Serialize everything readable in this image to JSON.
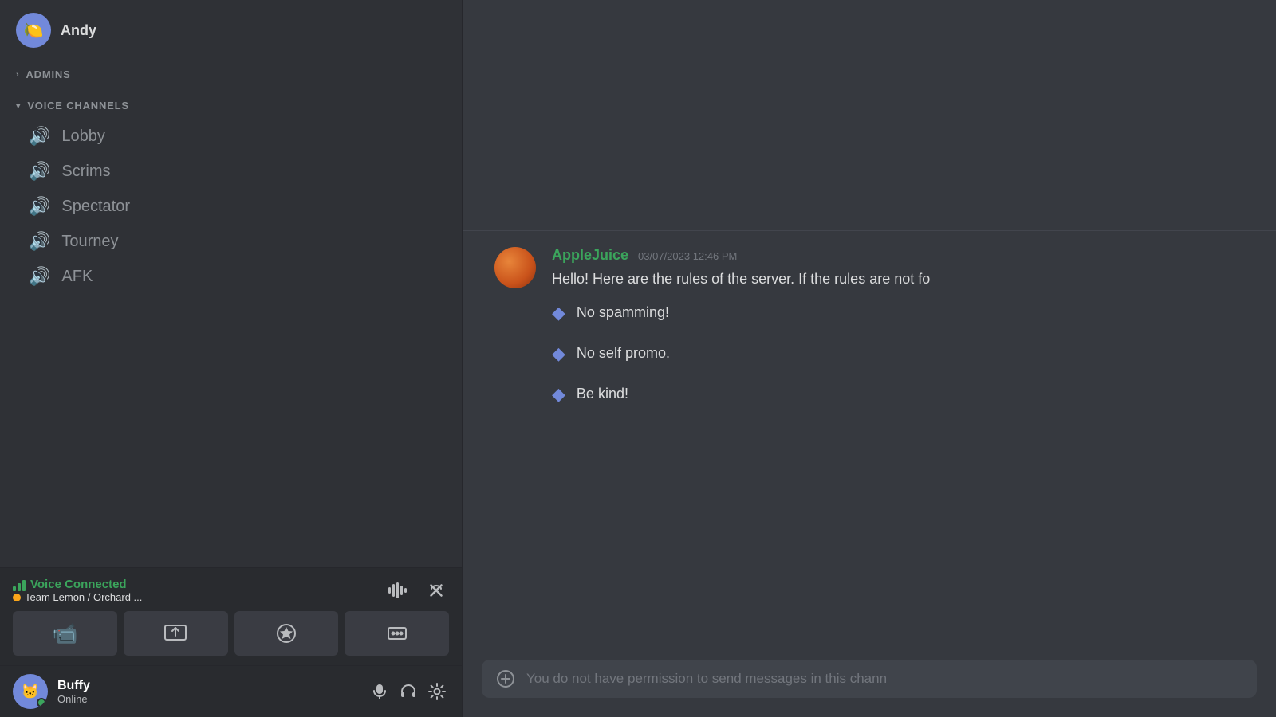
{
  "sidebar": {
    "partial_user": {
      "avatar_text": "🍋",
      "username": "Andy"
    },
    "sections": [
      {
        "id": "admins",
        "label": "ADMINS",
        "collapsed": true,
        "chevron": "▶"
      },
      {
        "id": "voice_channels",
        "label": "VOICE CHANNELS",
        "collapsed": false,
        "chevron": "▼"
      }
    ],
    "voice_channels": [
      {
        "id": "lobby",
        "name": "Lobby"
      },
      {
        "id": "scrims",
        "name": "Scrims"
      },
      {
        "id": "spectator",
        "name": "Spectator"
      },
      {
        "id": "tourney",
        "name": "Tourney"
      },
      {
        "id": "afk",
        "name": "AFK"
      }
    ],
    "voice_connected": {
      "label": "Voice Connected",
      "server_info": "Team Lemon / Orchard ...",
      "disconnect_title": "Disconnect"
    },
    "voice_buttons": [
      {
        "id": "camera",
        "icon": "📹",
        "label": "Camera"
      },
      {
        "id": "screen",
        "icon": "🖥",
        "label": "Share Screen"
      },
      {
        "id": "activity",
        "icon": "🚀",
        "label": "Activities"
      },
      {
        "id": "soundboard",
        "icon": "🎵",
        "label": "Soundboard"
      }
    ],
    "user": {
      "name": "Buffy",
      "status": "Online",
      "avatar_text": "🐱"
    }
  },
  "chat": {
    "message": {
      "username": "AppleJuice",
      "timestamp": "03/07/2023 12:46 PM",
      "intro": "Hello! Here are the rules of the server. If the rules are not fo",
      "rules": [
        "No spamming!",
        "No self promo.",
        "Be kind!"
      ]
    },
    "input": {
      "placeholder": "You do not have permission to send messages in this chann"
    },
    "add_button_icon": "+"
  },
  "icons": {
    "speaker": "🔊",
    "chevron_right": "›",
    "chevron_down": "⌄",
    "microphone": "🎙",
    "headphones": "🎧",
    "settings": "⚙",
    "disconnect": "✕",
    "sound_wave": "〰"
  }
}
